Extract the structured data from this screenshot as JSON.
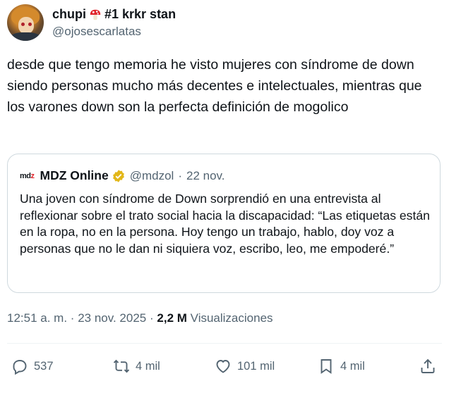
{
  "author": {
    "display_name": "chupi",
    "emoji_icon": "mushroom-icon",
    "name_suffix": "#1 krkr stan",
    "handle": "@ojosescarlatas"
  },
  "tweet": {
    "text": "desde que tengo memoria he visto mujeres con síndrome de down siendo personas mucho más decentes e intelectuales, mientras que los varones down son la perfecta definición de mogolico"
  },
  "quote": {
    "logo_text": "mdz",
    "name": "MDZ Online",
    "handle": "@mdzol",
    "separator": "·",
    "date": "22 nov.",
    "text": "Una joven con síndrome de Down sorprendió en una entrevista al reflexionar sobre el trato social hacia la discapacidad: “Las etiquetas están en la ropa, no en la persona. Hoy tengo un trabajo, hablo, doy voz a personas que no le dan ni siquiera voz, escribo, leo, me empoderé.”"
  },
  "meta": {
    "time": "12:51 a. m.",
    "separator": "·",
    "date": "23 nov. 2025",
    "views_count": "2,2 M",
    "views_label": "Visualizaciones"
  },
  "actions": {
    "replies": "537",
    "reposts": "4 mil",
    "likes": "101 mil",
    "bookmarks": "4 mil"
  },
  "colors": {
    "text": "#0f1419",
    "secondary": "#536471",
    "border": "#cfd9de",
    "verified_gold": "#e2b719",
    "logo_accent": "#e0242a"
  }
}
